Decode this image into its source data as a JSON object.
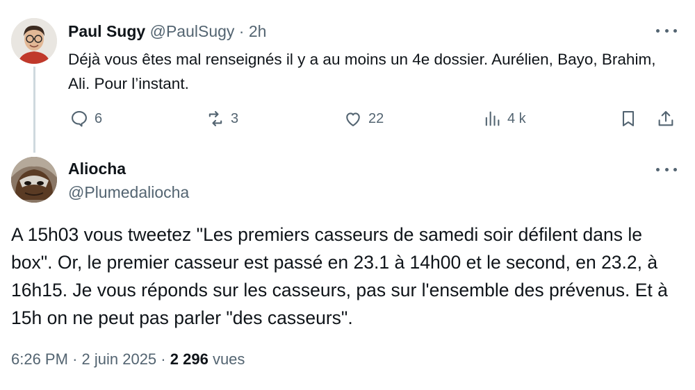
{
  "reply": {
    "author_name": "Paul Sugy",
    "author_handle": "@PaulSugy",
    "separator": "·",
    "time": "2h",
    "text": "Déjà vous êtes mal renseignés il y a au moins un 4e dossier. Aurélien, Bayo, Brahim, Ali. Pour l’instant.",
    "replies_count": "6",
    "reposts_count": "3",
    "likes_count": "22",
    "views_count": "4 k",
    "icons": [
      "reply-icon",
      "repost-icon",
      "like-icon",
      "views-icon",
      "bookmark-icon",
      "share-icon",
      "more-icon"
    ]
  },
  "main_tweet": {
    "author_name": "Aliocha",
    "author_handle": "@Plumedaliocha",
    "text": "A 15h03 vous tweetez \"Les premiers casseurs de samedi soir défilent dans le box\". Or, le premier casseur est passé en 23.1 à 14h00 et le second, en 23.2, à 16h15. Je vous réponds sur les casseurs, pas sur l'ensemble des prévenus. Et à 15h on ne peut pas parler \"des casseurs\".",
    "time": "6:26 PM",
    "date": "2 juin 2025",
    "separator": "·",
    "views_count": "2 296",
    "views_label": "vues"
  },
  "colors": {
    "text_primary": "#0f1419",
    "text_secondary": "#536471",
    "thread_line": "#cfd9de",
    "background": "#ffffff"
  }
}
